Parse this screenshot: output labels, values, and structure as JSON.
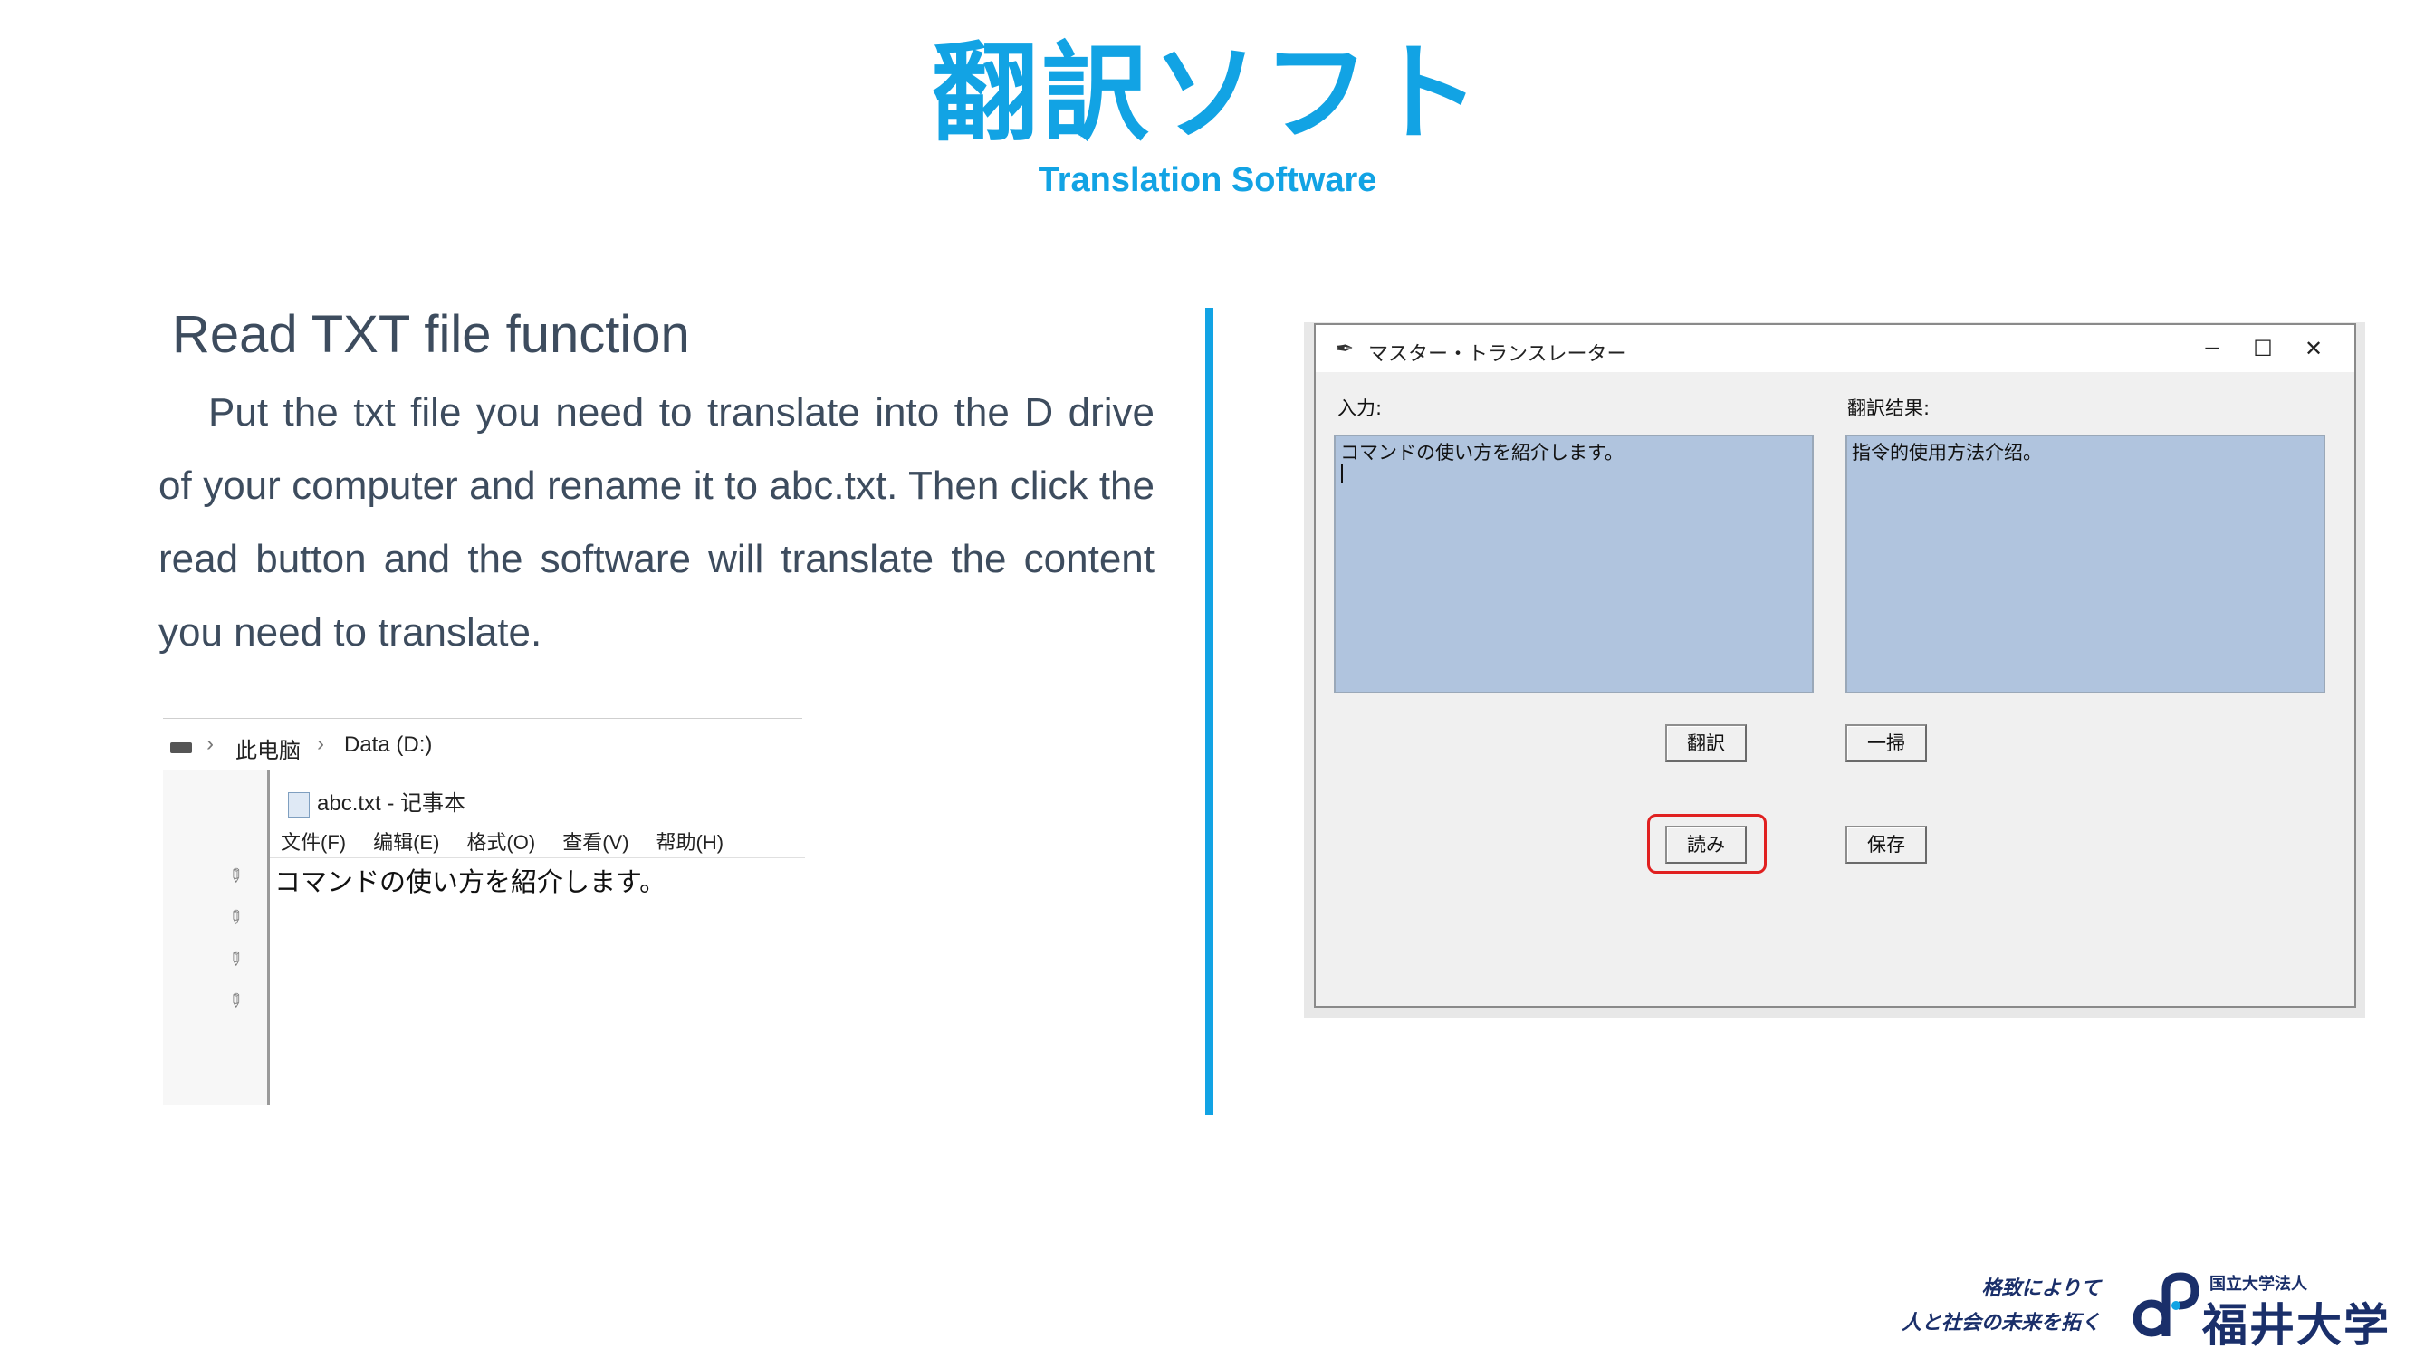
{
  "header": {
    "title": "翻訳ソフト",
    "subtitle": "Translation Software"
  },
  "section": {
    "heading": "Read TXT file function",
    "body": "Put the txt file you need to translate into the D drive of your computer and rename it to abc.txt. Then click the read button and the software will translate the content you need to translate."
  },
  "explorer": {
    "breadcrumb": [
      "此电脑",
      "Data (D:)"
    ],
    "icons": [
      "drive-icon",
      "chevron-right-icon",
      "pin-icon"
    ]
  },
  "notepad": {
    "title": "abc.txt - 记事本",
    "menu": [
      "文件(F)",
      "编辑(E)",
      "格式(O)",
      "查看(V)",
      "帮助(H)"
    ],
    "content": "コマンドの使い方を紹介します。"
  },
  "app": {
    "title": "マスター・トランスレーター",
    "window_buttons": {
      "minimize": "─",
      "maximize": "☐",
      "close": "✕"
    },
    "input_label": "入力:",
    "output_label": "翻訳结果:",
    "input_text": "コマンドの使い方を紹介します。",
    "output_text": "指令的使用方法介绍。",
    "buttons": {
      "translate": "翻訳",
      "clear": "一掃",
      "read": "読み",
      "save": "保存"
    },
    "highlighted_button": "read",
    "colors": {
      "textbox_bg": "#b0c4de",
      "highlight": "#e02020"
    }
  },
  "logo": {
    "slogan_line1": "格致によりて",
    "slogan_line2": "人と社会の未来を拓く",
    "org_small": "国立大学法人",
    "org_name": "福井大学"
  },
  "colors": {
    "accent": "#12a3e4",
    "text": "#3d4c5e",
    "logo": "#1a2f6a"
  }
}
